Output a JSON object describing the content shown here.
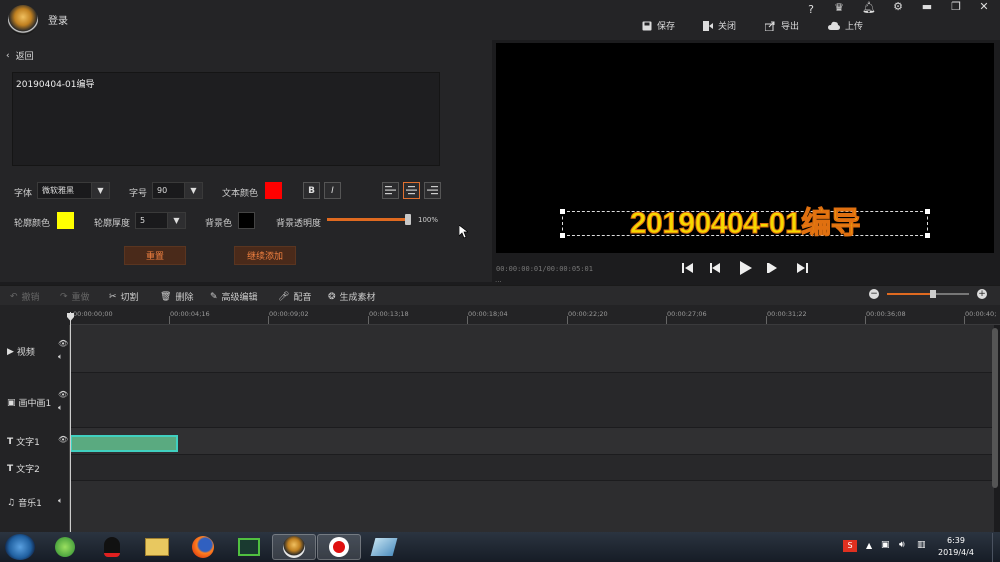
{
  "window": {
    "title": "登录"
  },
  "toolbar_top": {
    "save": "保存",
    "close": "关闭",
    "export": "导出",
    "upload": "上传"
  },
  "window_controls": {
    "help": "?"
  },
  "back": {
    "label": "返回"
  },
  "editor": {
    "text_value": "20190404-01编导",
    "font_label": "字体",
    "font_value": "微软雅黑",
    "size_label": "字号",
    "size_value": "90",
    "text_color_label": "文本颜色",
    "text_color": "#ff0000",
    "bold": "B",
    "italic": "I",
    "outline_color_label": "轮廓颜色",
    "outline_color": "#ffff00",
    "outline_thickness_label": "轮廓厚度",
    "outline_thickness_value": "5",
    "bg_color_label": "背景色",
    "bg_color": "#000000",
    "bg_opacity_label": "背景透明度",
    "bg_opacity_value": "100%",
    "bg_opacity": 1.0,
    "reset_button": "重置",
    "continue_add_button": "继续添加"
  },
  "preview": {
    "subtitle": "20190404-01编导",
    "timecode": "00:00:00:01/00:00:05:01"
  },
  "edit_toolbar": {
    "undo": "撤销",
    "redo": "重做",
    "cut": "切割",
    "delete": "删除",
    "advanced_edit": "高级编辑",
    "dub": "配音",
    "generate": "生成素材"
  },
  "ruler": {
    "ticks": [
      "00:00:00;00",
      "00:00:04;16",
      "00:00:09;02",
      "00:00:13;18",
      "00:00:18;04",
      "00:00:22;20",
      "00:00:27;06",
      "00:00:31;22",
      "00:00:36;08",
      "00:00:40;"
    ]
  },
  "tracks": [
    {
      "label": "视频"
    },
    {
      "label": "画中画1"
    },
    {
      "label": "文字1"
    },
    {
      "label": "文字2"
    },
    {
      "label": "音乐1"
    }
  ],
  "taskbar": {
    "time": "6:39",
    "date": "2019/4/4"
  }
}
